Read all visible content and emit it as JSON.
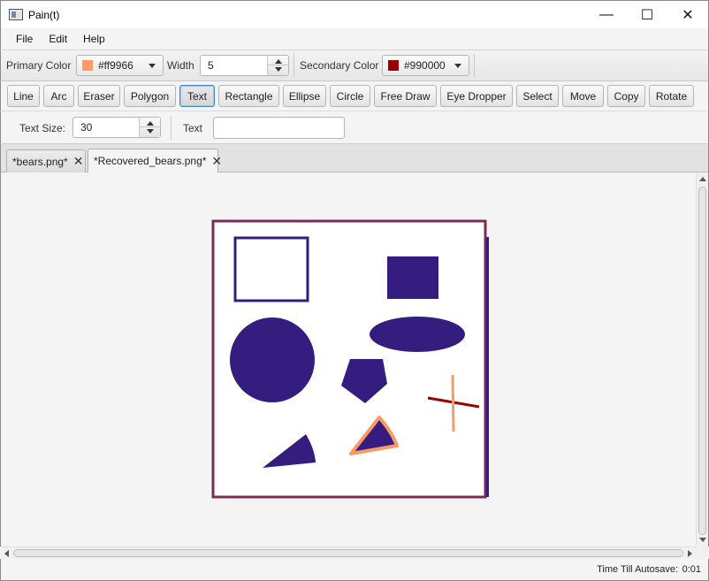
{
  "window": {
    "title": "Pain(t)",
    "minimize_symbol": "—",
    "maximize_symbol": "☐",
    "close_symbol": "✕"
  },
  "menu": [
    "File",
    "Edit",
    "Help"
  ],
  "options": {
    "primary_color_label": "Primary Color",
    "primary_color_value": "#ff9966",
    "width_label": "Width",
    "width_value": "5",
    "secondary_color_label": "Secondary Color",
    "secondary_color_value": "#990000"
  },
  "tools": [
    "Line",
    "Arc",
    "Eraser",
    "Polygon",
    "Text",
    "Rectangle",
    "Ellipse",
    "Circle",
    "Free Draw",
    "Eye Dropper",
    "Select",
    "Move",
    "Copy",
    "Rotate"
  ],
  "active_tool": "Text",
  "text_options": {
    "text_size_label": "Text Size:",
    "text_size_value": "30",
    "text_label": "Text",
    "text_value": ""
  },
  "tabs": [
    {
      "label": "*bears.png*",
      "selected": false
    },
    {
      "label": "*Recovered_bears.png*",
      "selected": true
    }
  ],
  "status": {
    "autosave_label": "Time Till Autosave:",
    "autosave_value": "0:01"
  },
  "drawing_colors": {
    "shape_fill": "#351d80",
    "border": "#7b2c55",
    "orange": "#f79a66",
    "dark_red": "#9b0000"
  }
}
